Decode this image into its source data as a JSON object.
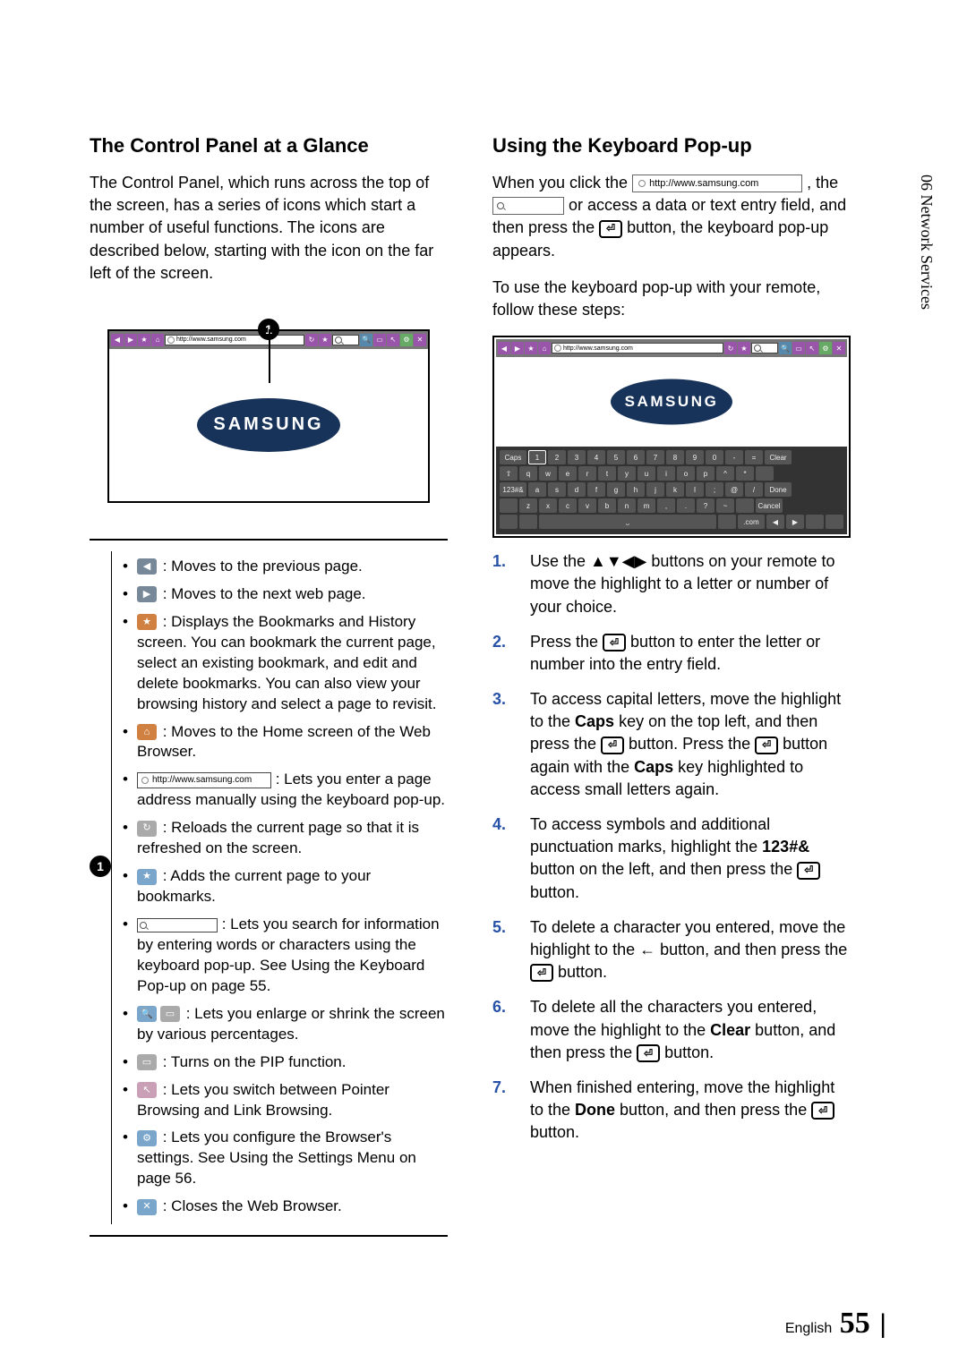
{
  "sideTab": "06   Network Services",
  "left": {
    "heading": "The Control Panel at a Glance",
    "intro": "The Control Panel, which runs across the top of the screen, has a series of icons which start a number of useful functions. The icons are described below, starting with the icon on the far left of the screen.",
    "calloutNum": "1",
    "url": "http://www.samsung.com",
    "logo": "SAMSUNG",
    "listNum": "1",
    "items": {
      "i0": " : Moves to the previous page.",
      "i1": " : Moves to the next web page.",
      "i2": " : Displays the Bookmarks and History screen. You can bookmark the current page, select an existing bookmark, and edit and delete bookmarks. You can also view your browsing history and select a page to revisit.",
      "i3": " : Moves to the Home screen of the Web Browser.",
      "i4a": " : Lets you enter a page address manually using the keyboard pop-up.",
      "i4url": "http://www.samsung.com",
      "i5": " : Reloads the current page so that it is refreshed on the screen.",
      "i6": " : Adds the current page to your bookmarks.",
      "i7": " : Lets you search for information by entering words or characters using the keyboard pop-up. See Using the Keyboard Pop-up on page 55.",
      "i8": " : Lets you enlarge or shrink the screen by various percentages.",
      "i9": " : Turns on the PIP function.",
      "i10": " : Lets you switch between Pointer Browsing and Link Browsing.",
      "i11": " : Lets you configure the Browser's settings. See Using the Settings Menu on page 56.",
      "i12": " : Closes the Web Browser."
    }
  },
  "right": {
    "heading": "Using the Keyboard Pop-up",
    "p1a": "When you click the ",
    "p1url": "http://www.samsung.com",
    "p1b": " , the ",
    "p1c": " or access a data or text entry field, and then press the ",
    "p1d": " button, the keyboard pop-up appears.",
    "p2": "To use the keyboard pop-up with your remote, follow these steps:",
    "kbUrl": "http://www.samsung.com",
    "logo": "SAMSUNG",
    "keys_r1": [
      "Caps",
      "1",
      "2",
      "3",
      "4",
      "5",
      "6",
      "7",
      "8",
      "9",
      "0",
      "-",
      "=",
      "Clear"
    ],
    "keys_r2": [
      "⇧",
      "q",
      "w",
      "e",
      "r",
      "t",
      "y",
      "u",
      "i",
      "o",
      "p",
      "^",
      "*",
      ""
    ],
    "keys_r3": [
      "123#&",
      "a",
      "s",
      "d",
      "f",
      "g",
      "h",
      "j",
      "k",
      "l",
      ";",
      "@",
      "/",
      "Done"
    ],
    "keys_r4": [
      "",
      "z",
      "x",
      "c",
      "v",
      "b",
      "n",
      "m",
      ",",
      ".",
      "?",
      "~",
      "",
      "Cancel"
    ],
    "keys_r5": [
      "",
      "",
      "⎵",
      "",
      ".com",
      "◀",
      "▶",
      "",
      ""
    ],
    "steps": {
      "s1": "Use the ▲▼◀▶ buttons on your remote to move the highlight to a letter or number of your choice.",
      "s2a": "Press the ",
      "s2b": " button to enter the letter or number into the entry field.",
      "s3a": "To access capital letters, move the highlight to the ",
      "s3b": "Caps",
      "s3c": " key on the top left, and then press the ",
      "s3d": " button. Press the ",
      "s3e": " button again with the ",
      "s3f": "Caps",
      "s3g": " key highlighted to access small letters again.",
      "s4a": "To access symbols and additional punctuation marks, highlight the ",
      "s4b": "123#&",
      "s4c": " button on the left, and then press the ",
      "s4d": " button.",
      "s5a": "To delete a character you entered, move the highlight to the ← button, and then press the ",
      "s5b": " button.",
      "s6a": "To delete all the characters you entered, move the highlight to the ",
      "s6b": "Clear",
      "s6c": " button, and then press the ",
      "s6d": " button.",
      "s7a": "When finished entering, move the highlight to the ",
      "s7b": "Done",
      "s7c": " button, and then press the ",
      "s7d": " button."
    }
  },
  "footer": {
    "lang": "English",
    "page": "55"
  }
}
